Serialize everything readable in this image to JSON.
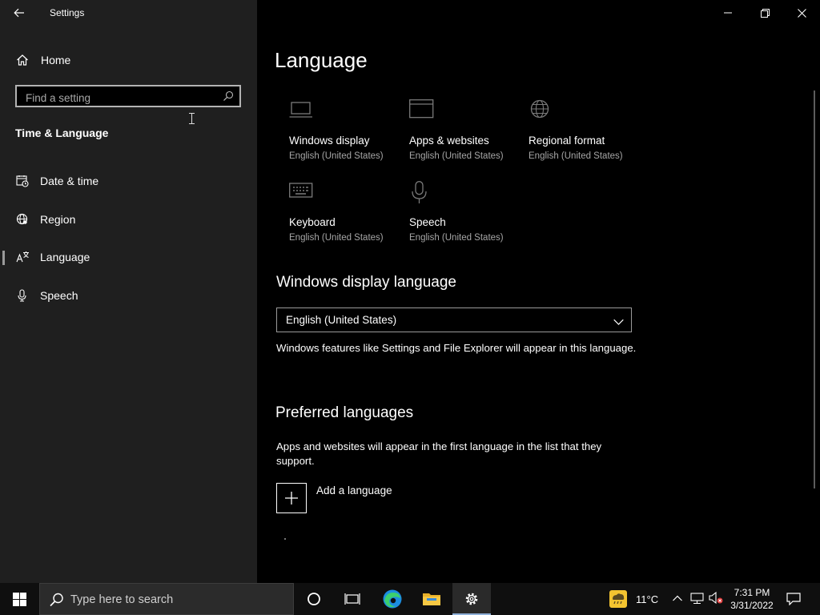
{
  "window": {
    "title": "Settings"
  },
  "sidebar": {
    "home_label": "Home",
    "search_placeholder": "Find a setting",
    "section_title": "Time & Language",
    "items": [
      {
        "label": "Date & time",
        "icon": "calendar-clock-icon"
      },
      {
        "label": "Region",
        "icon": "globe-icon"
      },
      {
        "label": "Language",
        "icon": "language-icon",
        "selected": true
      },
      {
        "label": "Speech",
        "icon": "microphone-icon"
      }
    ]
  },
  "main": {
    "title": "Language",
    "tiles": [
      {
        "name": "Windows display",
        "sub": "English (United States)",
        "icon": "laptop-icon"
      },
      {
        "name": "Apps & websites",
        "sub": "English (United States)",
        "icon": "app-window-icon"
      },
      {
        "name": "Regional format",
        "sub": "English (United States)",
        "icon": "regional-globe-icon"
      },
      {
        "name": "Keyboard",
        "sub": "English (United States)",
        "icon": "keyboard-icon"
      },
      {
        "name": "Speech",
        "sub": "English (United States)",
        "icon": "microphone-icon"
      }
    ],
    "display_language": {
      "heading": "Windows display language",
      "selected": "English (United States)",
      "description": "Windows features like Settings and File Explorer will appear in this language."
    },
    "preferred": {
      "heading": "Preferred languages",
      "description": "Apps and websites will appear in the first language in the list that they support.",
      "add_label": "Add a language"
    }
  },
  "taskbar": {
    "search_placeholder": "Type here to search",
    "weather_temp": "11°C",
    "time": "7:31 PM",
    "date": "3/31/2022",
    "accent": "#8fb0d8"
  }
}
